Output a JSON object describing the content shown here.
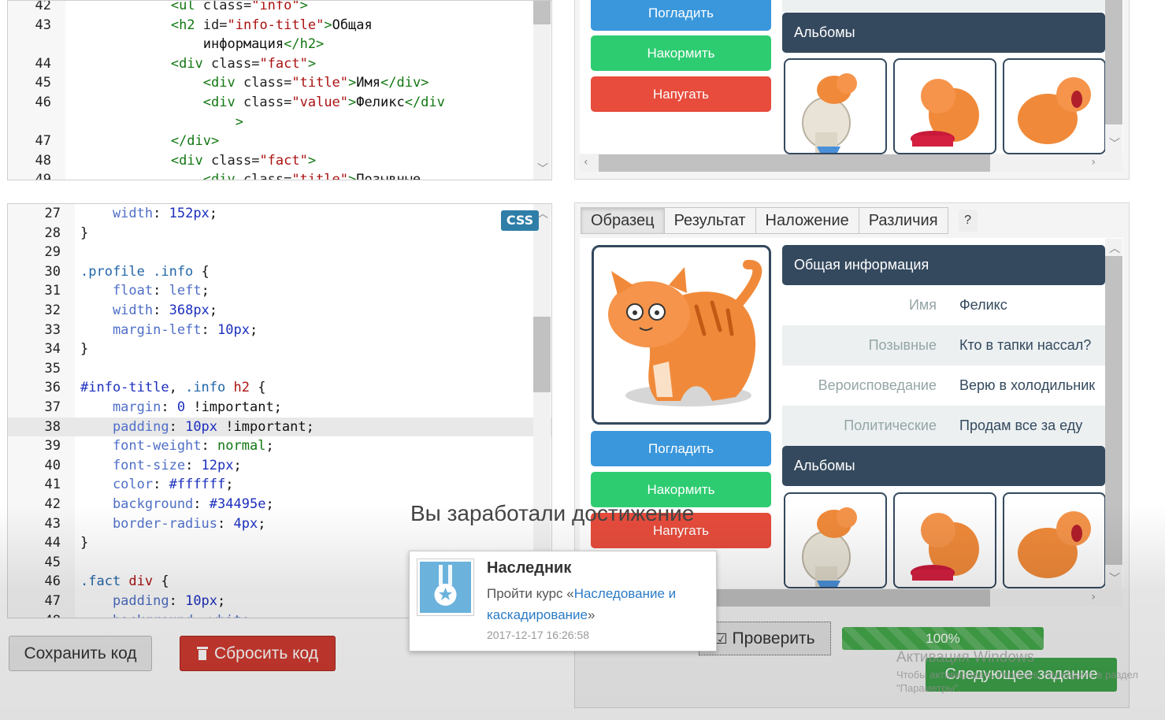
{
  "html_editor": {
    "lines": [
      {
        "num": "42",
        "indent": 0,
        "tokens": [
          {
            "c": "t-txt",
            "t": "            "
          },
          {
            "c": "t-tag",
            "t": "<ul"
          },
          {
            "c": "t-attr",
            "t": " class="
          },
          {
            "c": "t-str",
            "t": "\"info\""
          },
          {
            "c": "t-tag",
            "t": ">"
          }
        ]
      },
      {
        "num": "43",
        "indent": 0,
        "tokens": [
          {
            "c": "t-txt",
            "t": "            "
          },
          {
            "c": "t-tag",
            "t": "<h2"
          },
          {
            "c": "t-attr",
            "t": " id="
          },
          {
            "c": "t-str",
            "t": "\"info-title\""
          },
          {
            "c": "t-tag",
            "t": ">"
          },
          {
            "c": "t-txt",
            "t": "Общая"
          }
        ]
      },
      {
        "num": "",
        "indent": 0,
        "tokens": [
          {
            "c": "t-txt",
            "t": "                информация"
          },
          {
            "c": "t-tag",
            "t": "</h2>"
          }
        ]
      },
      {
        "num": "44",
        "indent": 0,
        "tokens": [
          {
            "c": "t-txt",
            "t": "            "
          },
          {
            "c": "t-tag",
            "t": "<div"
          },
          {
            "c": "t-attr",
            "t": " class="
          },
          {
            "c": "t-str",
            "t": "\"fact\""
          },
          {
            "c": "t-tag",
            "t": ">"
          }
        ]
      },
      {
        "num": "45",
        "indent": 0,
        "tokens": [
          {
            "c": "t-txt",
            "t": "                "
          },
          {
            "c": "t-tag",
            "t": "<div"
          },
          {
            "c": "t-attr",
            "t": " class="
          },
          {
            "c": "t-str",
            "t": "\"title\""
          },
          {
            "c": "t-tag",
            "t": ">"
          },
          {
            "c": "t-txt",
            "t": "Имя"
          },
          {
            "c": "t-tag",
            "t": "</div>"
          }
        ]
      },
      {
        "num": "46",
        "indent": 0,
        "tokens": [
          {
            "c": "t-txt",
            "t": "                "
          },
          {
            "c": "t-tag",
            "t": "<div"
          },
          {
            "c": "t-attr",
            "t": " class="
          },
          {
            "c": "t-str",
            "t": "\"value\""
          },
          {
            "c": "t-tag",
            "t": ">"
          },
          {
            "c": "t-txt",
            "t": "Феликс"
          },
          {
            "c": "t-tag",
            "t": "</div"
          }
        ]
      },
      {
        "num": "",
        "indent": 0,
        "tokens": [
          {
            "c": "t-txt",
            "t": "                    "
          },
          {
            "c": "t-tag",
            "t": ">"
          }
        ]
      },
      {
        "num": "47",
        "indent": 0,
        "tokens": [
          {
            "c": "t-txt",
            "t": "            "
          },
          {
            "c": "t-tag",
            "t": "</div>"
          }
        ]
      },
      {
        "num": "48",
        "indent": 0,
        "tokens": [
          {
            "c": "t-txt",
            "t": "            "
          },
          {
            "c": "t-tag",
            "t": "<div"
          },
          {
            "c": "t-attr",
            "t": " class="
          },
          {
            "c": "t-str",
            "t": "\"fact\""
          },
          {
            "c": "t-tag",
            "t": ">"
          }
        ]
      },
      {
        "num": "49",
        "indent": 0,
        "tokens": [
          {
            "c": "t-txt",
            "t": "                "
          },
          {
            "c": "t-tag",
            "t": "<div"
          },
          {
            "c": "t-attr",
            "t": " class="
          },
          {
            "c": "t-str",
            "t": "\"title\""
          },
          {
            "c": "t-tag",
            "t": ">"
          },
          {
            "c": "t-txt",
            "t": "Позывные"
          }
        ]
      }
    ]
  },
  "css_editor": {
    "badge": "CSS",
    "lines": [
      {
        "num": "27",
        "tokens": [
          {
            "c": "t-prop",
            "t": "    width"
          },
          {
            "c": "t-punc",
            "t": ": "
          },
          {
            "c": "t-num",
            "t": "152px"
          },
          {
            "c": "t-punc",
            "t": ";"
          }
        ]
      },
      {
        "num": "28",
        "tokens": [
          {
            "c": "t-punc",
            "t": "}"
          }
        ]
      },
      {
        "num": "29",
        "tokens": []
      },
      {
        "num": "30",
        "tokens": [
          {
            "c": "t-sel",
            "t": ".profile .info"
          },
          {
            "c": "t-punc",
            "t": " {"
          }
        ]
      },
      {
        "num": "31",
        "tokens": [
          {
            "c": "t-prop",
            "t": "    float"
          },
          {
            "c": "t-punc",
            "t": ": "
          },
          {
            "c": "t-prop",
            "t": "left"
          },
          {
            "c": "t-punc",
            "t": ";"
          }
        ]
      },
      {
        "num": "32",
        "tokens": [
          {
            "c": "t-prop",
            "t": "    width"
          },
          {
            "c": "t-punc",
            "t": ": "
          },
          {
            "c": "t-num",
            "t": "368px"
          },
          {
            "c": "t-punc",
            "t": ";"
          }
        ]
      },
      {
        "num": "33",
        "tokens": [
          {
            "c": "t-prop",
            "t": "    margin-left"
          },
          {
            "c": "t-punc",
            "t": ": "
          },
          {
            "c": "t-num",
            "t": "10px"
          },
          {
            "c": "t-punc",
            "t": ";"
          }
        ]
      },
      {
        "num": "34",
        "tokens": [
          {
            "c": "t-punc",
            "t": "}"
          }
        ]
      },
      {
        "num": "35",
        "tokens": []
      },
      {
        "num": "36",
        "tokens": [
          {
            "c": "t-num",
            "t": "#info-title"
          },
          {
            "c": "t-punc",
            "t": ", "
          },
          {
            "c": "t-sel",
            "t": ".info "
          },
          {
            "c": "t-tagsel",
            "t": "h2"
          },
          {
            "c": "t-punc",
            "t": " {"
          }
        ]
      },
      {
        "num": "37",
        "tokens": [
          {
            "c": "t-prop",
            "t": "    margin"
          },
          {
            "c": "t-punc",
            "t": ": "
          },
          {
            "c": "t-num",
            "t": "0"
          },
          {
            "c": "t-punc",
            "t": " !important;"
          }
        ]
      },
      {
        "num": "38",
        "active": true,
        "tokens": [
          {
            "c": "t-prop",
            "t": "    padding"
          },
          {
            "c": "t-punc",
            "t": ": "
          },
          {
            "c": "t-num",
            "t": "10px"
          },
          {
            "c": "t-punc",
            "t": " !important;"
          }
        ]
      },
      {
        "num": "39",
        "tokens": [
          {
            "c": "t-prop",
            "t": "    font-weight"
          },
          {
            "c": "t-punc",
            "t": ": "
          },
          {
            "c": "t-kw",
            "t": "normal"
          },
          {
            "c": "t-punc",
            "t": ";"
          }
        ]
      },
      {
        "num": "40",
        "tokens": [
          {
            "c": "t-prop",
            "t": "    font-size"
          },
          {
            "c": "t-punc",
            "t": ": "
          },
          {
            "c": "t-num",
            "t": "12px"
          },
          {
            "c": "t-punc",
            "t": ";"
          }
        ]
      },
      {
        "num": "41",
        "tokens": [
          {
            "c": "t-prop",
            "t": "    color"
          },
          {
            "c": "t-punc",
            "t": ": "
          },
          {
            "c": "t-num",
            "t": "#ffffff"
          },
          {
            "c": "t-punc",
            "t": ";"
          }
        ]
      },
      {
        "num": "42",
        "tokens": [
          {
            "c": "t-prop",
            "t": "    background"
          },
          {
            "c": "t-punc",
            "t": ": "
          },
          {
            "c": "t-num",
            "t": "#34495e"
          },
          {
            "c": "t-punc",
            "t": ";"
          }
        ]
      },
      {
        "num": "43",
        "tokens": [
          {
            "c": "t-prop",
            "t": "    border-radius"
          },
          {
            "c": "t-punc",
            "t": ": "
          },
          {
            "c": "t-num",
            "t": "4px"
          },
          {
            "c": "t-punc",
            "t": ";"
          }
        ]
      },
      {
        "num": "44",
        "tokens": [
          {
            "c": "t-punc",
            "t": "}"
          }
        ]
      },
      {
        "num": "45",
        "tokens": []
      },
      {
        "num": "46",
        "tokens": [
          {
            "c": "t-sel",
            "t": ".fact "
          },
          {
            "c": "t-tagsel",
            "t": "div"
          },
          {
            "c": "t-punc",
            "t": " {"
          }
        ]
      },
      {
        "num": "47",
        "tokens": [
          {
            "c": "t-prop",
            "t": "    padding"
          },
          {
            "c": "t-punc",
            "t": ": "
          },
          {
            "c": "t-num",
            "t": "10px"
          },
          {
            "c": "t-punc",
            "t": ";"
          }
        ]
      },
      {
        "num": "48",
        "tokens": [
          {
            "c": "t-prop",
            "t": "    background"
          },
          {
            "c": "t-punc",
            "t": ": "
          },
          {
            "c": "t-prop",
            "t": "white"
          },
          {
            "c": "t-punc",
            "t": ";"
          }
        ]
      }
    ]
  },
  "left_buttons": {
    "save": "Сохранить код",
    "reset": "Сбросить код",
    "reset_icon": "trash-icon"
  },
  "preview_top": {
    "buttons": [
      "Погладить",
      "Накормить",
      "Напугать"
    ],
    "albums_title": "Альбомы"
  },
  "preview_main": {
    "tabs": [
      "Образец",
      "Результат",
      "Наложение",
      "Различия"
    ],
    "active_tab": "Образец",
    "help": "?",
    "info_title": "Общая информация",
    "facts": [
      {
        "title": "Имя",
        "value": "Феликс"
      },
      {
        "title": "Позывные",
        "value": "Кто в тапки нассал?"
      },
      {
        "title": "Вероисповедание",
        "value": "Верю в холодильник"
      },
      {
        "title": "Политические",
        "value": "Продам все за еду"
      }
    ],
    "buttons": [
      "Погладить",
      "Накормить",
      "Напугать"
    ],
    "albums_title": "Альбомы"
  },
  "achievement": {
    "heading": "Вы заработали достижение",
    "name": "Наследник",
    "desc_prefix": "Пройти курс «",
    "desc_link": "Наследование и каскадирование",
    "desc_suffix": "»",
    "time": "2017-12-17 16:26:58",
    "icon": "medal-icon"
  },
  "bottom_controls": {
    "check": "Проверить",
    "check_icon": "checkbox-icon",
    "progress_label": "100%",
    "progress_value": 1.0,
    "next": "Следующее задание"
  },
  "windows_watermark": {
    "line1": "Активация Windows",
    "line2": "Чтобы активировать Windows, перейдите в раздел",
    "line3": "\"Параметры\"."
  },
  "colors": {
    "header_bg": "#34495e",
    "blue": "#3a97dc",
    "green": "#2ecc71",
    "red": "#e74c3c"
  }
}
